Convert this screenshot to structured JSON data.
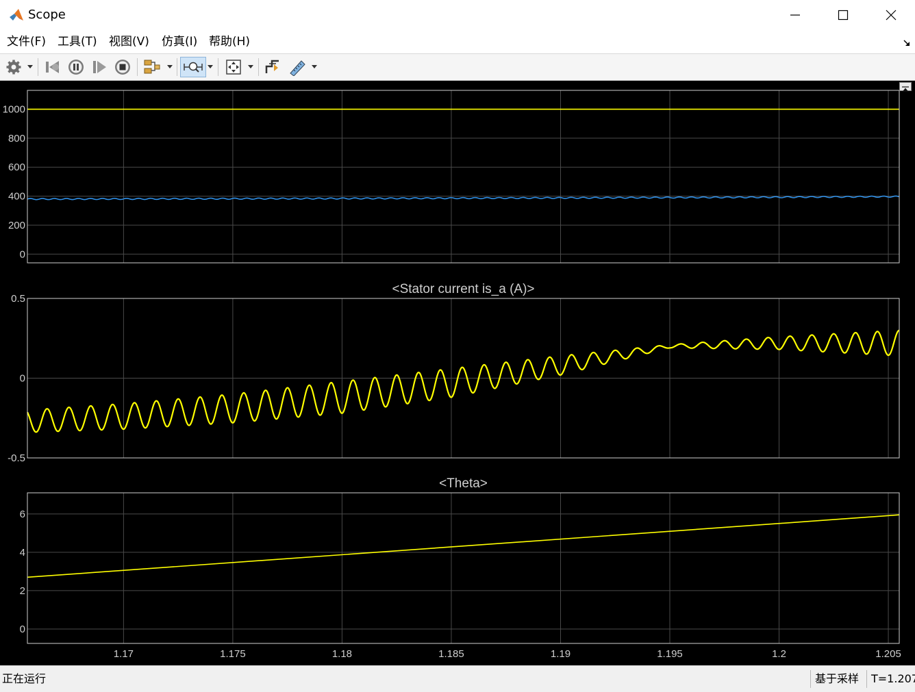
{
  "window": {
    "title": "Scope",
    "icon": "matlab-logo-icon",
    "controls": [
      "minimize-icon",
      "maximize-icon",
      "close-icon"
    ]
  },
  "menu": {
    "items": [
      {
        "label": "文件(F)"
      },
      {
        "label": "工具(T)"
      },
      {
        "label": "视图(V)"
      },
      {
        "label": "仿真(I)"
      },
      {
        "label": "帮助(H)"
      }
    ]
  },
  "toolbar": {
    "icons": [
      "gear-icon",
      "step-back-icon",
      "pause-icon",
      "step-forward-icon",
      "stop-icon",
      "highlight-block-icon",
      "zoom-icon",
      "autoscale-icon",
      "trigger-icon",
      "measurements-icon"
    ]
  },
  "colors": {
    "background": "#000000",
    "yellow": "#ffff00",
    "blue": "#2f8fe6",
    "axis": "#cfcfcf",
    "grid": "#4a4a4a"
  },
  "chart_data": [
    {
      "type": "line",
      "title": "",
      "xlim": [
        1.1656,
        1.2055
      ],
      "ylim": [
        -60,
        1130
      ],
      "yticks": [
        "0",
        "200",
        "400",
        "600",
        "800",
        "1000"
      ],
      "ytick_values": [
        0,
        200,
        400,
        600,
        800,
        1000
      ],
      "grid": true,
      "series": [
        {
          "color": "#ffff00",
          "x": [
            1.1656,
            1.2055
          ],
          "y": [
            1000,
            1000
          ]
        },
        {
          "color": "#2f8fe6",
          "x": [
            1.1656,
            1.17,
            1.18,
            1.19,
            1.2,
            1.2055
          ],
          "y": [
            380,
            381,
            384,
            388,
            393,
            397
          ],
          "ripple": 4,
          "ripple_period": 0.00055
        }
      ]
    },
    {
      "type": "line",
      "title": "<Stator current is_a (A)>",
      "xlim": [
        1.1656,
        1.2055
      ],
      "ylim": [
        -0.5,
        0.5
      ],
      "yticks": [
        "-0.5",
        "0",
        "0.5"
      ],
      "ytick_values": [
        -0.5,
        0,
        0.5
      ],
      "grid": true,
      "series": [
        {
          "color": "#ffff00",
          "type": "sinusoid",
          "period": 0.001,
          "x": [
            1.1656,
            1.17,
            1.175,
            1.18,
            1.185,
            1.19,
            1.195,
            1.2,
            1.2055
          ],
          "mean": [
            -0.27,
            -0.24,
            -0.19,
            -0.12,
            -0.03,
            0.08,
            0.2,
            0.22,
            0.22
          ],
          "amplitude": [
            0.07,
            0.08,
            0.09,
            0.1,
            0.09,
            0.06,
            0.01,
            0.04,
            0.08
          ]
        }
      ]
    },
    {
      "type": "line",
      "title": "<Theta>",
      "xlim": [
        1.1656,
        1.2055
      ],
      "ylim": [
        -0.75,
        7.1
      ],
      "yticks": [
        "0",
        "2",
        "4",
        "6"
      ],
      "ytick_values": [
        0,
        2,
        4,
        6
      ],
      "xticks": [
        "1.17",
        "1.175",
        "1.18",
        "1.185",
        "1.19",
        "1.195",
        "1.2",
        "1.205"
      ],
      "xtick_values": [
        1.17,
        1.175,
        1.18,
        1.185,
        1.19,
        1.195,
        1.2,
        1.205
      ],
      "grid": true,
      "series": [
        {
          "color": "#ffff00",
          "x": [
            1.1656,
            1.2055
          ],
          "y": [
            2.7,
            5.95
          ]
        }
      ]
    }
  ],
  "status": {
    "left": "正在运行",
    "mode": "基于采样",
    "time": "T=1.207"
  }
}
